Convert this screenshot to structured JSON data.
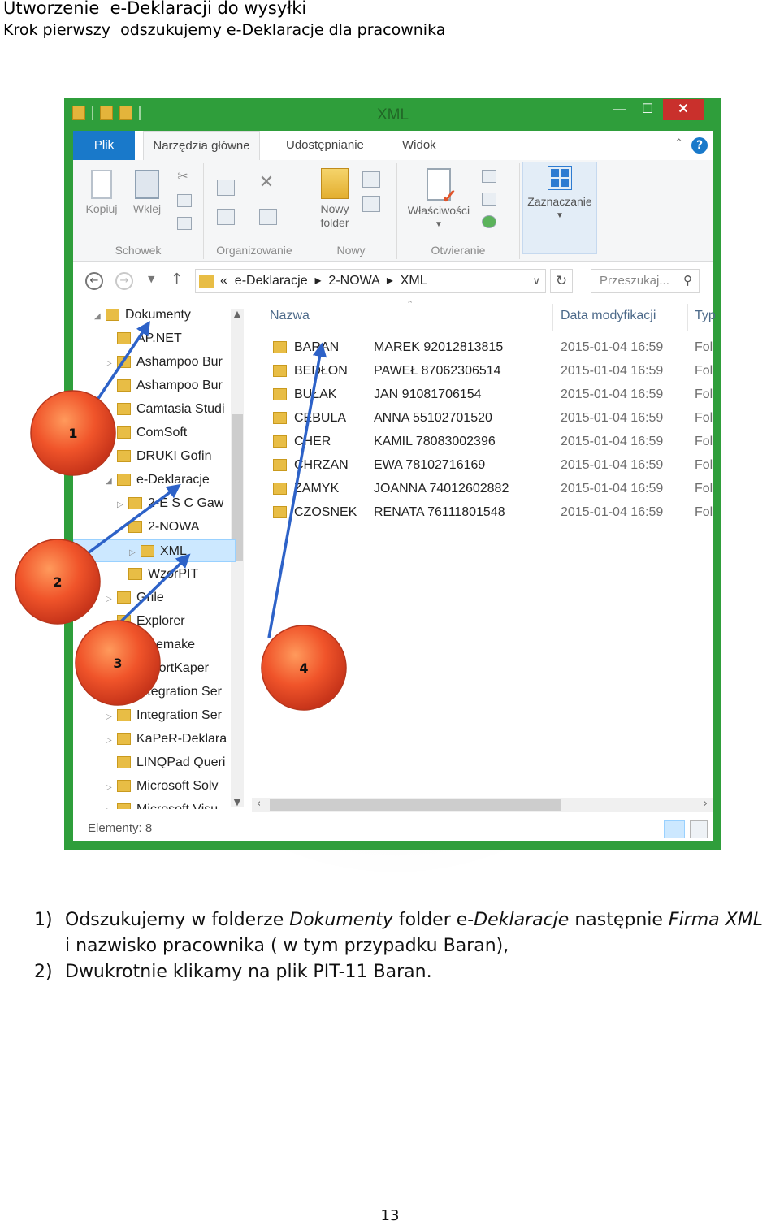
{
  "doc": {
    "title": "Utworzenie  e-Deklaracji do wysyłki",
    "subtitle": "Krok pierwszy  odszukujemy e-Deklaracje dla pracownika",
    "page_number": "13"
  },
  "window": {
    "title": "XML",
    "tabs": {
      "file": "Plik",
      "home": "Narzędzia główne",
      "share": "Udostępnianie",
      "view": "Widok"
    },
    "ribbon": {
      "copy": "Kopiuj",
      "paste": "Wklej",
      "group_clipboard": "Schowek",
      "group_organize": "Organizowanie",
      "new_folder": "Nowy folder",
      "group_new": "Nowy",
      "properties": "Właściwości",
      "group_open": "Otwieranie",
      "select": "Zaznaczanie"
    },
    "address": {
      "crumbs": "«  e-Deklaracje  ▸  2-NOWA  ▸  XML",
      "search_placeholder": "Przeszukaj..."
    },
    "tree": [
      {
        "label": "Dokumenty",
        "level": 0,
        "arrow": "◢"
      },
      {
        "label": "AP.NET",
        "level": 1,
        "arrow": ""
      },
      {
        "label": "Ashampoo Bur",
        "level": 1,
        "arrow": "▷"
      },
      {
        "label": "Ashampoo Bur",
        "level": 1,
        "arrow": ""
      },
      {
        "label": "Camtasia Studi",
        "level": 1,
        "arrow": ""
      },
      {
        "label": "ComSoft",
        "level": 1,
        "arrow": ""
      },
      {
        "label": "DRUKI Gofin",
        "level": 1,
        "arrow": ""
      },
      {
        "label": "e-Deklaracje",
        "level": 1,
        "arrow": "◢"
      },
      {
        "label": "2-E S C  Gaw",
        "level": 2,
        "arrow": "▷"
      },
      {
        "label": "2-NOWA",
        "level": 2,
        "arrow": ""
      },
      {
        "label": "XML",
        "level": 3,
        "arrow": "▷",
        "selected": true
      },
      {
        "label": "WzorPIT",
        "level": 2,
        "arrow": ""
      },
      {
        "label": "Grile",
        "level": 1,
        "arrow": "▷"
      },
      {
        "label": "Explorer",
        "level": 1,
        "arrow": ""
      },
      {
        "label": "Freemake",
        "level": 1,
        "arrow": ""
      },
      {
        "label": "ExportKaper",
        "level": 1,
        "arrow": ""
      },
      {
        "label": "Integration Ser",
        "level": 1,
        "arrow": ""
      },
      {
        "label": "Integration Ser",
        "level": 1,
        "arrow": "▷"
      },
      {
        "label": "KaPeR-Deklara",
        "level": 1,
        "arrow": "▷"
      },
      {
        "label": "LINQPad Queri",
        "level": 1,
        "arrow": ""
      },
      {
        "label": "Microsoft Solv",
        "level": 1,
        "arrow": "▷"
      },
      {
        "label": "Microsoft Visu",
        "level": 1,
        "arrow": "▷"
      }
    ],
    "columns": {
      "name": "Nazwa",
      "date": "Data modyfikacji",
      "type": "Typ"
    },
    "files": [
      {
        "name": "BARAN",
        "comment": "MAREK 92012813815",
        "date": "2015-01-04 16:59",
        "type": "Fol"
      },
      {
        "name": "BEDŁON",
        "comment": "PAWEŁ 87062306514",
        "date": "2015-01-04 16:59",
        "type": "Fol"
      },
      {
        "name": "BUŁAK",
        "comment": "JAN 91081706154",
        "date": "2015-01-04 16:59",
        "type": "Fol"
      },
      {
        "name": "CEBULA",
        "comment": "ANNA 55102701520",
        "date": "2015-01-04 16:59",
        "type": "Fol"
      },
      {
        "name": "CHER",
        "comment": "KAMIL 78083002396",
        "date": "2015-01-04 16:59",
        "type": "Fol"
      },
      {
        "name": "CHRZAN",
        "comment": "EWA 78102716169",
        "date": "2015-01-04 16:59",
        "type": "Fol"
      },
      {
        "name": "ZAMYK",
        "comment": "JOANNA 74012602882",
        "date": "2015-01-04 16:59",
        "type": "Fol"
      },
      {
        "name": "CZOSNEK",
        "comment": "RENATA 76111801548",
        "date": "2015-01-04 16:59",
        "type": "Fol"
      }
    ],
    "status": "Elementy: 8"
  },
  "annotations": [
    "1",
    "2",
    "3",
    "4"
  ],
  "caption": [
    {
      "number": "1)",
      "parts": [
        {
          "text": "Odszukujemy w folderze ",
          "italic": false
        },
        {
          "text": "Dokumenty",
          "italic": true
        },
        {
          "text": " folder e-",
          "italic": false
        },
        {
          "text": "Deklaracje",
          "italic": true
        },
        {
          "text": " następnie ",
          "italic": false
        },
        {
          "text": "Firma XML",
          "italic": true
        },
        {
          "text": " i nazwisko pracownika ( w tym przypadku Baran),",
          "italic": false
        }
      ]
    },
    {
      "number": "2)",
      "parts": [
        {
          "text": "Dwukrotnie klikamy na plik PIT-11 Baran.",
          "italic": false
        }
      ]
    }
  ]
}
